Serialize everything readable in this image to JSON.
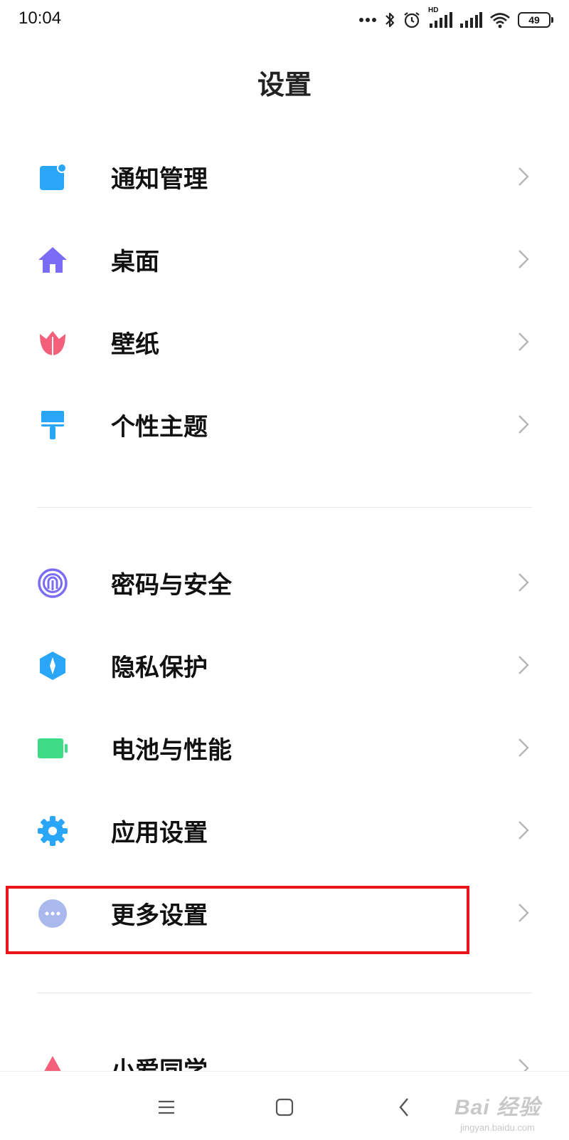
{
  "status_bar": {
    "time": "10:04",
    "battery": "49",
    "network": "HD"
  },
  "page_title": "设置",
  "groups": [
    {
      "items": [
        {
          "label": "通知管理",
          "icon": "notification-icon",
          "color": "#2aa6f8"
        },
        {
          "label": "桌面",
          "icon": "home-icon",
          "color": "#7b6cf6"
        },
        {
          "label": "壁纸",
          "icon": "tulip-icon",
          "color": "#f4607a"
        },
        {
          "label": "个性主题",
          "icon": "brush-icon",
          "color": "#2aa6f8"
        }
      ]
    },
    {
      "items": [
        {
          "label": "密码与安全",
          "icon": "fingerprint-icon",
          "color": "#7b6cf6"
        },
        {
          "label": "隐私保护",
          "icon": "privacy-shield-icon",
          "color": "#2aa6f8"
        },
        {
          "label": "电池与性能",
          "icon": "battery-icon",
          "color": "#3ddc84"
        },
        {
          "label": "应用设置",
          "icon": "gear-icon",
          "color": "#2aa6f8"
        },
        {
          "label": "更多设置",
          "icon": "more-dots-icon",
          "color": "#a9b9ee",
          "highlighted": true
        }
      ]
    },
    {
      "items": [
        {
          "label": "小爱同学",
          "icon": "xiaoai-icon",
          "color": "#f4607a"
        }
      ]
    }
  ],
  "nav_bar": {
    "buttons": [
      "menu-icon",
      "home-square-icon",
      "back-icon"
    ]
  },
  "watermark": {
    "main": "Bai 经验",
    "sub": "jingyan.baidu.com"
  },
  "colors": {
    "highlight": "#e8141a",
    "text": "#111111",
    "chevron": "#b5b5b5"
  }
}
